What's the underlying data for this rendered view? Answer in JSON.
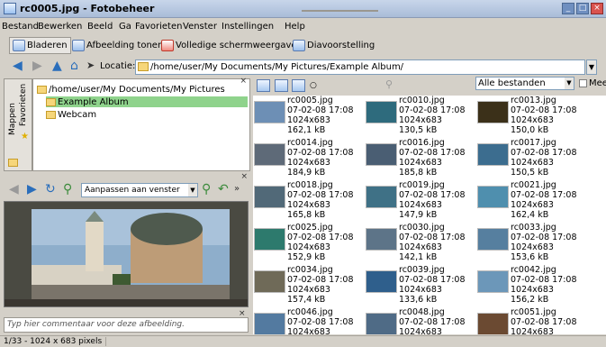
{
  "window": {
    "title": "rc0005.jpg - Fotobeheer"
  },
  "menu": [
    "Bestand",
    "Bewerken",
    "Beeld",
    "Ga",
    "Favorieten",
    "Venster",
    "Instellingen",
    "Help"
  ],
  "toolbar": {
    "browse": "Bladeren",
    "show_image": "Afbeelding tonen",
    "fullscreen": "Volledige schermweergave",
    "slideshow": "Diavoorstelling"
  },
  "location": {
    "label": "Locatie:",
    "path": "/home/user/My Documents/My Pictures/Example Album/"
  },
  "side_tabs": [
    "Mappen",
    "Favorieten"
  ],
  "tree": {
    "root": "/home/user/My Documents/My Pictures",
    "items": [
      "Example Album",
      "Webcam"
    ]
  },
  "viewer": {
    "zoom": "Aanpassen aan venster"
  },
  "comment": {
    "placeholder": "Typ hier commentaar voor deze afbeelding."
  },
  "status": {
    "text": "1/33 - 1024 x 683 pixels"
  },
  "grid": {
    "filter": "Alle bestanden",
    "more_label": "Mee",
    "items": [
      {
        "name": "rc0005.jpg",
        "date": "07-02-08 17:08",
        "dims": "1024x683",
        "size": "162,1 kB",
        "color": "#6d8fb5"
      },
      {
        "name": "rc0010.jpg",
        "date": "07-02-08 17:08",
        "dims": "1024x683",
        "size": "130,5 kB",
        "color": "#2e6b7d"
      },
      {
        "name": "rc0013.jpg",
        "date": "07-02-08 17:08",
        "dims": "1024x683",
        "size": "150,0 kB",
        "color": "#3b3019"
      },
      {
        "name": "rc0014.jpg",
        "date": "07-02-08 17:08",
        "dims": "1024x683",
        "size": "184,9 kB",
        "color": "#5e6a78"
      },
      {
        "name": "rc0016.jpg",
        "date": "07-02-08 17:08",
        "dims": "1024x683",
        "size": "185,8 kB",
        "color": "#4a5e73"
      },
      {
        "name": "rc0017.jpg",
        "date": "07-02-08 17:08",
        "dims": "1024x683",
        "size": "150,5 kB",
        "color": "#3c6d8f"
      },
      {
        "name": "rc0018.jpg",
        "date": "07-02-08 17:08",
        "dims": "1024x683",
        "size": "165,8 kB",
        "color": "#516978"
      },
      {
        "name": "rc0019.jpg",
        "date": "07-02-08 17:08",
        "dims": "1024x683",
        "size": "147,9 kB",
        "color": "#3f7186"
      },
      {
        "name": "rc0021.jpg",
        "date": "07-02-08 17:08",
        "dims": "1024x683",
        "size": "162,4 kB",
        "color": "#4f8fae"
      },
      {
        "name": "rc0025.jpg",
        "date": "07-02-08 17:08",
        "dims": "1024x683",
        "size": "152,9 kB",
        "color": "#2d7a6d"
      },
      {
        "name": "rc0030.jpg",
        "date": "07-02-08 17:08",
        "dims": "1024x683",
        "size": "142,1 kB",
        "color": "#5d7488"
      },
      {
        "name": "rc0033.jpg",
        "date": "07-02-08 17:08",
        "dims": "1024x683",
        "size": "153,6 kB",
        "color": "#567f9f"
      },
      {
        "name": "rc0034.jpg",
        "date": "07-02-08 17:08",
        "dims": "1024x683",
        "size": "157,4 kB",
        "color": "#6f6a58"
      },
      {
        "name": "rc0039.jpg",
        "date": "07-02-08 17:08",
        "dims": "1024x683",
        "size": "133,6 kB",
        "color": "#2f5f8c"
      },
      {
        "name": "rc0042.jpg",
        "date": "07-02-08 17:08",
        "dims": "1024x683",
        "size": "156,2 kB",
        "color": "#6c97b9"
      },
      {
        "name": "rc0046.jpg",
        "date": "07-02-08 17:08",
        "dims": "1024x683",
        "size": "",
        "color": "#537aa0"
      },
      {
        "name": "rc0048.jpg",
        "date": "07-02-08 17:08",
        "dims": "1024x683",
        "size": "",
        "color": "#4f6b86"
      },
      {
        "name": "rc0051.jpg",
        "date": "07-02-08 17:08",
        "dims": "1024x683",
        "size": "",
        "color": "#6b4a32"
      }
    ]
  }
}
